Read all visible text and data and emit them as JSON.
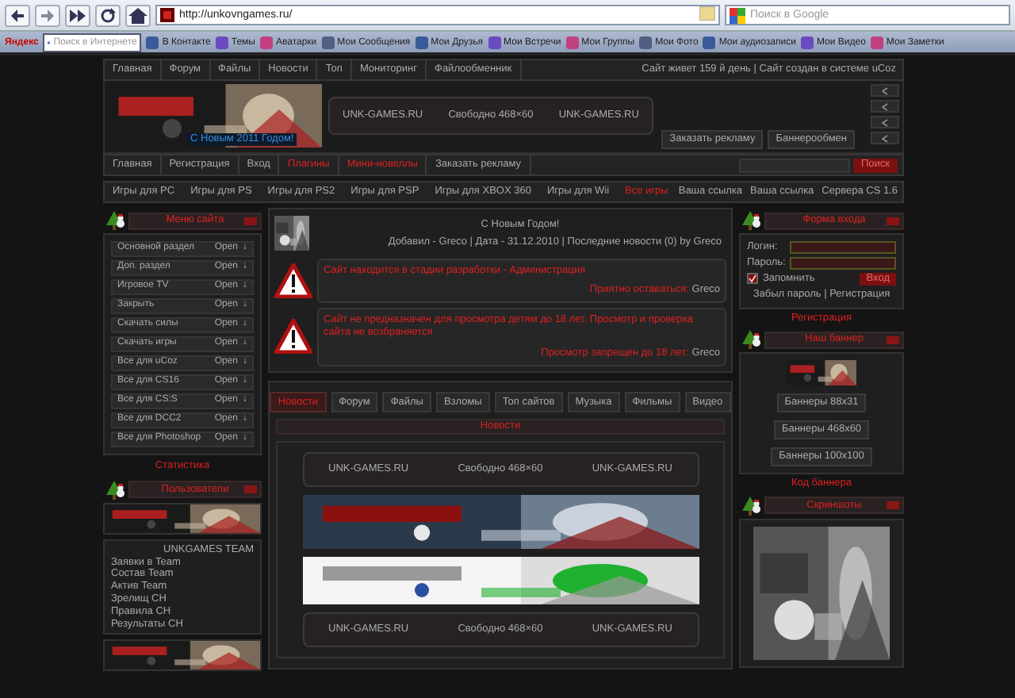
{
  "browser": {
    "address": "http://unkovngames.ru/",
    "search_placeholder": "Поиск в Google"
  },
  "bookmarks_bar": {
    "logo": "Яндекс",
    "search_placeholder": "Поиск в Интернете",
    "links": [
      "В Контакте",
      "Темы",
      "Аватарки",
      "Мои Сообщения",
      "Мои Друзья",
      "Мои Встречи",
      "Мои Группы",
      "Мои Фото",
      "Мои аудиозаписи",
      "Мои Видео",
      "Мои Заметки"
    ]
  },
  "top_menu": {
    "items": [
      "Главная",
      "Форум",
      "Файлы",
      "Новости",
      "Топ",
      "Мониторинг",
      "Файлообменник"
    ],
    "info": "Сайт живет 159 й день | Сайт создан в системе uCoz"
  },
  "header": {
    "greeting": "С Новым 2011 Годом!",
    "ad_strip": [
      "UNK-GAMES.RU",
      "Свободно 468×60",
      "UNK-GAMES.RU"
    ],
    "buttons": [
      "Заказать рекламу",
      "Баннерообмен"
    ]
  },
  "main_menu": {
    "items": [
      {
        "label": "Главная",
        "highlighted": false
      },
      {
        "label": "Регистрация",
        "highlighted": false
      },
      {
        "label": "Вход",
        "highlighted": false
      },
      {
        "label": "Плагины",
        "highlighted": true
      },
      {
        "label": "Мини-новеллы",
        "highlighted": true
      },
      {
        "label": "Заказать рекламу",
        "highlighted": false
      }
    ],
    "search_button": "Поиск"
  },
  "games_menu": {
    "items": [
      {
        "label": "Игры для PC",
        "highlighted": false
      },
      {
        "label": "Игры для PS",
        "highlighted": false
      },
      {
        "label": "Игры для PS2",
        "highlighted": false
      },
      {
        "label": "Игры для PSP",
        "highlighted": false
      },
      {
        "label": "Игры для XBOX 360",
        "highlighted": false
      },
      {
        "label": "Игры для Wii",
        "highlighted": false
      },
      {
        "label": "Все игры",
        "highlighted": true
      }
    ],
    "links": [
      "Ваша ссылка",
      "Ваша ссылка",
      "Сервера CS 1.6"
    ]
  },
  "left": {
    "menu_title": "Меню сайта",
    "menu_items": [
      {
        "label": "Основной раздел",
        "action": "Open",
        "arrow": "↓"
      },
      {
        "label": "Доп. раздел",
        "action": "Open",
        "arrow": "↓"
      },
      {
        "label": "Игровое TV",
        "action": "Open",
        "arrow": "↓"
      },
      {
        "label": "Закрыть",
        "action": "Open",
        "arrow": "↓"
      },
      {
        "label": "Скачать силы",
        "action": "Open",
        "arrow": "↓"
      },
      {
        "label": "Скачать игры",
        "action": "Open",
        "arrow": "↓"
      },
      {
        "label": "Все для uCoz",
        "action": "Open",
        "arrow": "↓"
      },
      {
        "label": "Все для CS16",
        "action": "Open",
        "arrow": "↓"
      },
      {
        "label": "Все для CS:S",
        "action": "Open",
        "arrow": "↓"
      },
      {
        "label": "Все для DCC2",
        "action": "Open",
        "arrow": "↓"
      },
      {
        "label": "Все для Photoshop",
        "action": "Open",
        "arrow": "↓"
      }
    ],
    "stats_caption": "Статистика",
    "users_title": "Пользователи",
    "team_title": "UNKGAMES TEAM",
    "team_lines": [
      "Заявки в Team",
      "Состав Team",
      "Актив Team",
      "Зрелищ CH",
      "Правила CH",
      "Результаты CH"
    ]
  },
  "news": {
    "title": "С Новым Годом!",
    "meta": "Добавил - Greco | Дата - 31.12.2010 | Последние новости (0) by Greco",
    "alerts": [
      {
        "text": "Сайт находится в стадии разработки - Администрация",
        "footer": "Приятно оставаться:",
        "author": "Greco"
      },
      {
        "text": "Сайт не предназначен для просмотра детям до 18 лет. Просмотр и проверка сайта не возбраняется",
        "footer": "Просмотр запрещен до 18 лет:",
        "author": "Greco"
      }
    ]
  },
  "tabs": [
    {
      "label": "Новости",
      "selected": true
    },
    {
      "label": "Форум",
      "selected": false
    },
    {
      "label": "Файлы",
      "selected": false
    },
    {
      "label": "Взломы",
      "selected": false
    },
    {
      "label": "Топ сайтов",
      "selected": false
    },
    {
      "label": "Музыка",
      "selected": false
    },
    {
      "label": "Фильмы",
      "selected": false
    },
    {
      "label": "Видео",
      "selected": false
    }
  ],
  "tab_panel": {
    "title": "Новости",
    "ad_strip_top": [
      "UNK-GAMES.RU",
      "Свободно 468×60",
      "UNK-GAMES.RU"
    ],
    "ad_strip_bottom": [
      "UNK-GAMES.RU",
      "Свободно 468×60",
      "UNK-GAMES.RU"
    ]
  },
  "right": {
    "login_title": "Форма входа",
    "login_label": "Логин:",
    "password_label": "Пароль:",
    "remember": {
      "label": "Запомнить",
      "checked": true
    },
    "login_button": "Вход",
    "links": "Забыл пароль | Регистрация",
    "register_caption": "Регистрация",
    "banner_title": "Наш баннер",
    "banner_buttons": [
      "Баннеры 88x31",
      "Баннеры 468x60",
      "Баннеры 100x100"
    ],
    "banner_caption": "Код баннера",
    "screens_title": "Скриншоты"
  }
}
